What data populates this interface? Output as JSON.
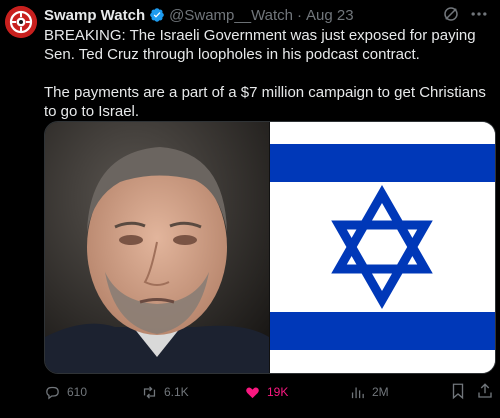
{
  "tweet": {
    "author": {
      "name": "Swamp Watch",
      "handle": "@Swamp__Watch",
      "verified": true,
      "avatar_icon": "swamp-watch-logo-icon"
    },
    "date": "Aug 23",
    "separator": "·",
    "paragraphs": [
      "BREAKING: The Israeli Government was just exposed for paying Sen. Ted Cruz through loopholes in his podcast contract.",
      "The payments are a part of a $7 million campaign to get Christians to go to Israel."
    ],
    "media": {
      "left_image": "portrait-photo",
      "right_image": "israel-flag"
    },
    "actions": {
      "replies": "610",
      "reposts": "6.1K",
      "likes": "19K",
      "views": "2M"
    }
  },
  "colors": {
    "background": "#000000",
    "text": "#e7e9ea",
    "muted": "#71767b",
    "verified_blue": "#1d9bf0",
    "like_pink": "#f91880",
    "flag_blue": "#0038b8"
  }
}
